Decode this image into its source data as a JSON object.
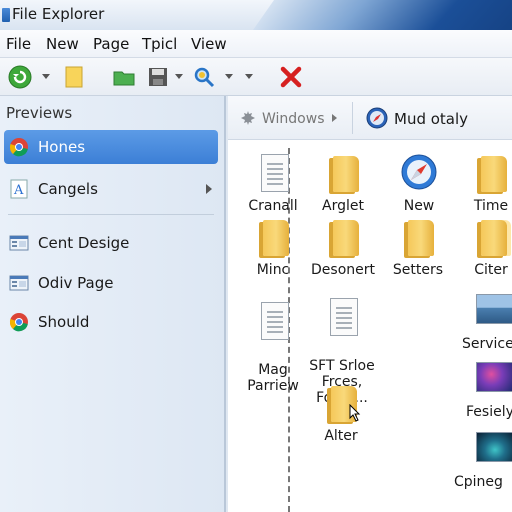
{
  "window": {
    "title": "File Explorer"
  },
  "menu": [
    "File",
    "New",
    "Page",
    "Tpicl",
    "View"
  ],
  "sidebar": {
    "header": "Previews",
    "items": [
      {
        "label": "Hones",
        "icon": "chrome-icon"
      },
      {
        "label": "Cangels",
        "icon": "a-letter-icon"
      },
      {
        "label": "Cent Desige",
        "icon": "settings-window-icon"
      },
      {
        "label": "Odiv Page",
        "icon": "settings-window-icon"
      },
      {
        "label": "Should",
        "icon": "chrome-icon"
      }
    ]
  },
  "breadcrumb": {
    "first": "Windows",
    "second": "Mud otaly"
  },
  "files": [
    {
      "label": "Cranall",
      "icon": "document-stack-icon"
    },
    {
      "label": "Arglet",
      "icon": "folder-icon"
    },
    {
      "label": "New",
      "icon": "safari-compass-icon"
    },
    {
      "label": "Time",
      "icon": "folder-icon"
    },
    {
      "label": "Minc",
      "icon": "folder-icon"
    },
    {
      "label": "Desonert",
      "icon": "folder-icon"
    },
    {
      "label": "Setters",
      "icon": "folder-icon"
    },
    {
      "label": "Citer",
      "icon": "folder-icon"
    },
    {
      "label": "Mag\nParriew",
      "icon": "document-stack-icon"
    },
    {
      "label": "SFT Srloe\nFrces,\nFome...",
      "icon": "text-document-icon"
    },
    {
      "label": "Service",
      "icon": "image-thumbnail-icon"
    },
    {
      "label": "Alter",
      "icon": "folder-icon"
    },
    {
      "label": "Fesiely",
      "icon": "image-thumbnail-icon"
    },
    {
      "label": "Cpineg",
      "icon": "image-thumbnail-icon"
    }
  ]
}
